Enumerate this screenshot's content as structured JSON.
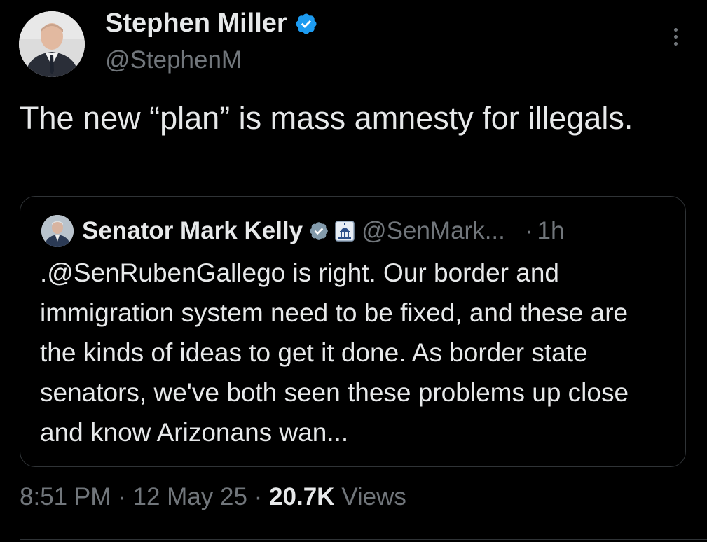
{
  "tweet": {
    "author": {
      "name": "Stephen Miller",
      "handle": "@StephenM",
      "verified": true
    },
    "text": "The new “plan” is mass amnesty for illegals.",
    "quoted": {
      "name": "Senator Mark Kelly",
      "handle": "@SenMark...",
      "separator": "·",
      "time": "1h",
      "verified": true,
      "affiliation_icon": "capitol-building-icon",
      "text": ".@SenRubenGallego is right. Our border and immigration system need to be fixed, and these are the kinds of ideas to get it done. As border state senators, we've both seen these problems up close and know Arizonans wan..."
    },
    "meta": {
      "time": "8:51 PM",
      "sep1": "·",
      "date": "12 May 25",
      "sep2": "·",
      "views_count": "20.7K",
      "views_label": "Views"
    }
  },
  "colors": {
    "background": "#000000",
    "text_primary": "#e7e9ea",
    "text_secondary": "#71767b",
    "border": "#2f3336",
    "verified_blue": "#1d9bf0",
    "verified_gray": "#829aab"
  }
}
